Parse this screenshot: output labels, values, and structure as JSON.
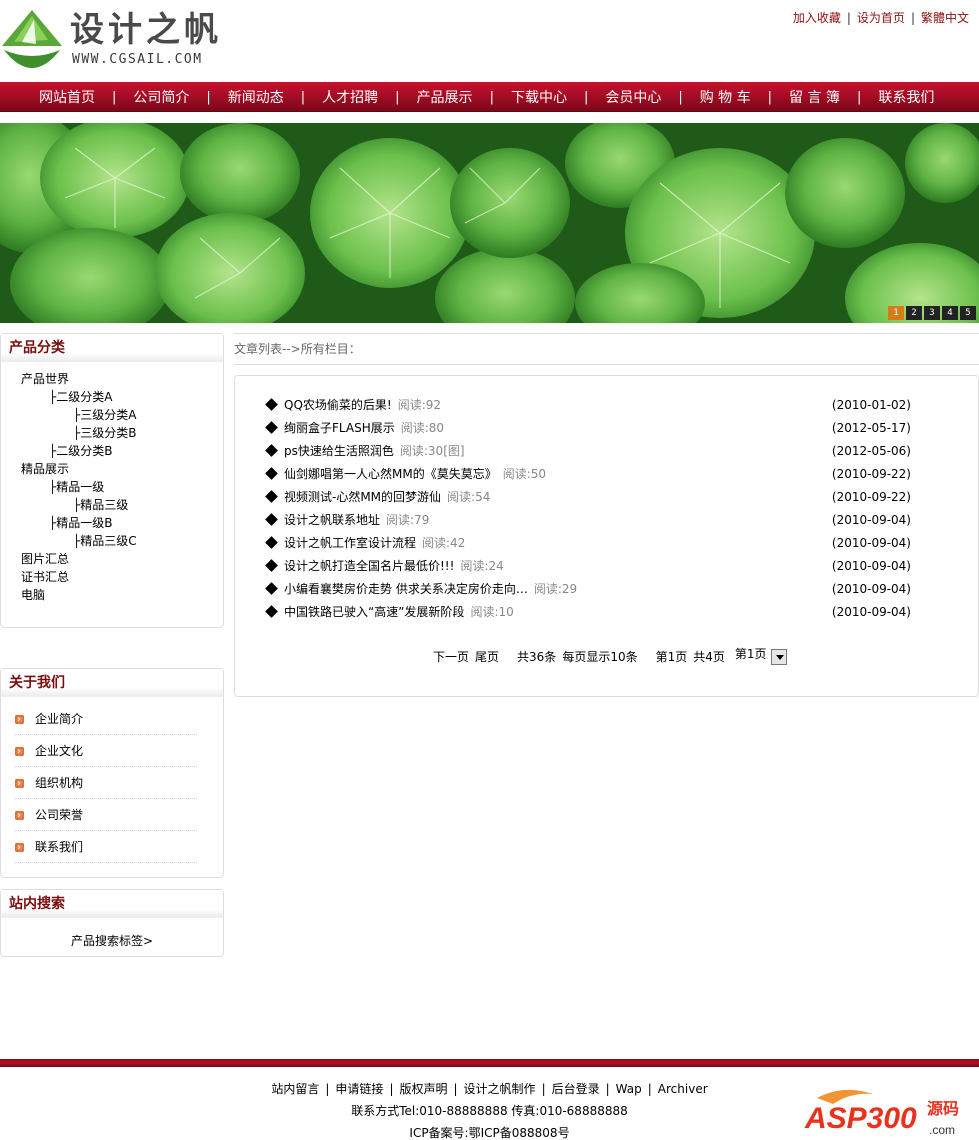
{
  "header": {
    "logo_title": "设计之帆",
    "logo_sub": "WWW.CGSAIL.COM",
    "top_links": [
      "加入收藏",
      "设为首页",
      "繁體中文"
    ]
  },
  "nav": {
    "items": [
      "网站首页",
      "公司简介",
      "新闻动态",
      "人才招聘",
      "产品展示",
      "下载中心",
      "会员中心",
      "购 物 车",
      "留 言 簿",
      "联系我们"
    ],
    "separator": "|"
  },
  "banner": {
    "pager": [
      "1",
      "2",
      "3",
      "4",
      "5"
    ],
    "active_page": "1"
  },
  "categories": {
    "title": "产品分类",
    "items": [
      {
        "label": "产品世界",
        "level": 0
      },
      {
        "label": "├二级分类A",
        "level": 1
      },
      {
        "label": "├三级分类A",
        "level": 2
      },
      {
        "label": "├三级分类B",
        "level": 2
      },
      {
        "label": "├二级分类B",
        "level": 1
      },
      {
        "label": "精品展示",
        "level": 0
      },
      {
        "label": "├精品一级",
        "level": 1
      },
      {
        "label": "├精品三级",
        "level": 2
      },
      {
        "label": "├精品一级B",
        "level": 1
      },
      {
        "label": "├精品三级C",
        "level": 2
      },
      {
        "label": "图片汇总",
        "level": 0
      },
      {
        "label": "证书汇总",
        "level": 0
      },
      {
        "label": "电脑",
        "level": 0
      }
    ]
  },
  "about": {
    "title": "关于我们",
    "items": [
      "企业简介",
      "企业文化",
      "组织机构",
      "公司荣誉",
      "联系我们"
    ]
  },
  "search": {
    "title": "站内搜索",
    "tag_link": "产品搜索标签>"
  },
  "breadcrumb": "文章列表-->所有栏目：",
  "articles": [
    {
      "title": "QQ农场偷菜的后果!",
      "reads": "阅读:92",
      "date": "(2010-01-02)"
    },
    {
      "title": "绚丽盒子FLASH展示",
      "reads": "阅读:80",
      "date": "(2012-05-17)"
    },
    {
      "title": "ps快速给生活照润色",
      "reads": "阅读:30[图]",
      "date": "(2012-05-06)"
    },
    {
      "title": "仙剑娜唱第一人心然MM的《莫失莫忘》",
      "reads": "阅读:50",
      "date": "(2010-09-22)"
    },
    {
      "title": "视频测试-心然MM的回梦游仙",
      "reads": "阅读:54",
      "date": "(2010-09-22)"
    },
    {
      "title": "设计之帆联系地址",
      "reads": "阅读:79",
      "date": "(2010-09-04)"
    },
    {
      "title": "设计之帆工作室设计流程",
      "reads": "阅读:42",
      "date": "(2010-09-04)"
    },
    {
      "title": "设计之帆打造全国名片最低价!!!",
      "reads": "阅读:24",
      "date": "(2010-09-04)"
    },
    {
      "title": "小编看襄樊房价走势 供求关系决定房价走向…",
      "reads": "阅读:29",
      "date": "(2010-09-04)"
    },
    {
      "title": "中国铁路已驶入“高速”发展新阶段",
      "reads": "阅读:10",
      "date": "(2010-09-04)"
    }
  ],
  "pagination": {
    "next": "下一页",
    "last": "尾页",
    "total": "共36条",
    "per_page": "每页显示10条",
    "current": "第1页",
    "pages": "共4页",
    "select_value": "第1页"
  },
  "footer": {
    "links": [
      "站内留言",
      "申请链接",
      "版权声明",
      "设计之帆制作",
      "后台登录",
      "Wap",
      "Archiver"
    ],
    "contact": "联系方式Tel:010-88888888 传真:010-68888888",
    "icp": "ICP备案号:鄂ICP备088808号",
    "watermark": "ASP300源码",
    "watermark_sub": ".com"
  },
  "colors": {
    "nav_red": "#a60d26",
    "title_dark_red": "#7a0d0d",
    "pager_active": "#d77a1a",
    "leaf_green": "#4aa33a"
  },
  "icons": {
    "logo": "sail-logo-icon",
    "bullet": "orange-arrow-bullet-icon",
    "article_marker": "black-diamond-icon",
    "dropdown": "chevron-down-icon"
  }
}
